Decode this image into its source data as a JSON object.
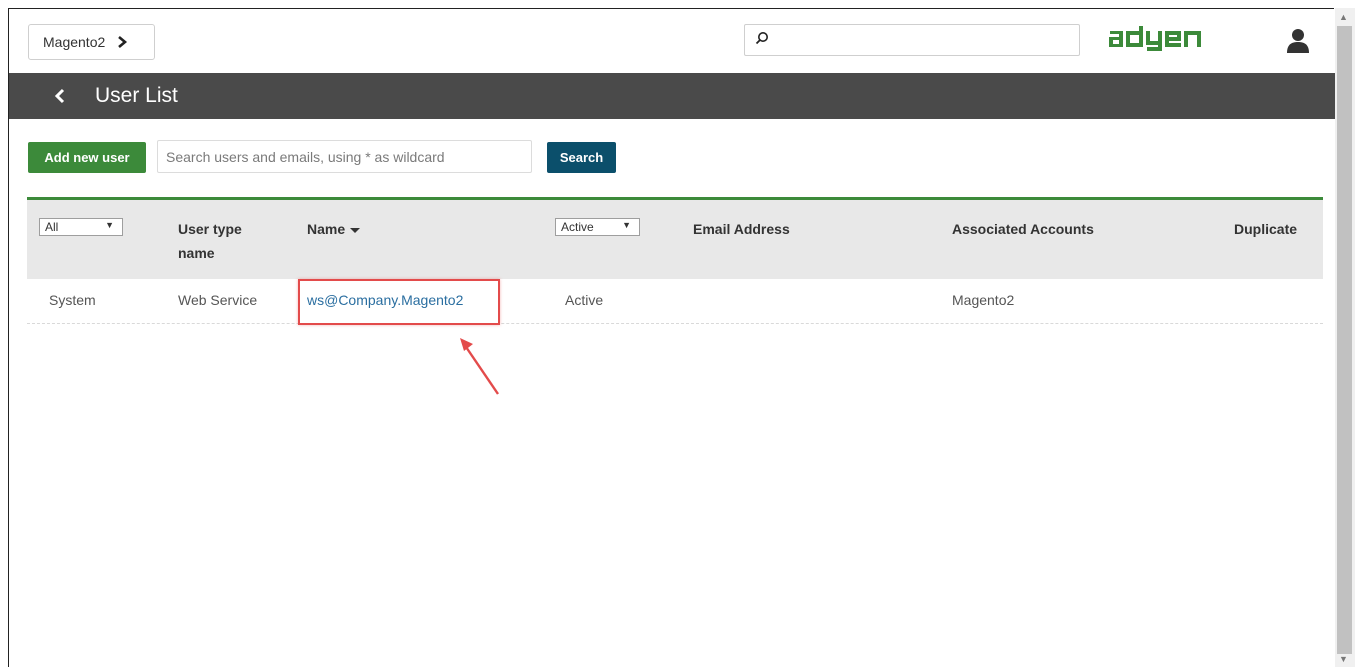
{
  "header": {
    "account_label": "Magento2",
    "logo_text": "adyen",
    "brand_color": "#3c8a3a"
  },
  "titlebar": {
    "title": "User List"
  },
  "toolbar": {
    "add_label": "Add new user",
    "search_placeholder": "Search users and emails, using * as wildcard",
    "search_label": "Search"
  },
  "table": {
    "filter_type": "All",
    "col_user_type": "User type name",
    "col_name": "Name",
    "filter_status": "Active",
    "col_email": "Email Address",
    "col_accounts": "Associated Accounts",
    "col_duplicate": "Duplicate",
    "rows": [
      {
        "type": "System",
        "user_type": "Web Service",
        "name": "ws@Company.Magento2",
        "status": "Active",
        "email": "",
        "accounts": "Magento2",
        "duplicate": ""
      }
    ]
  }
}
